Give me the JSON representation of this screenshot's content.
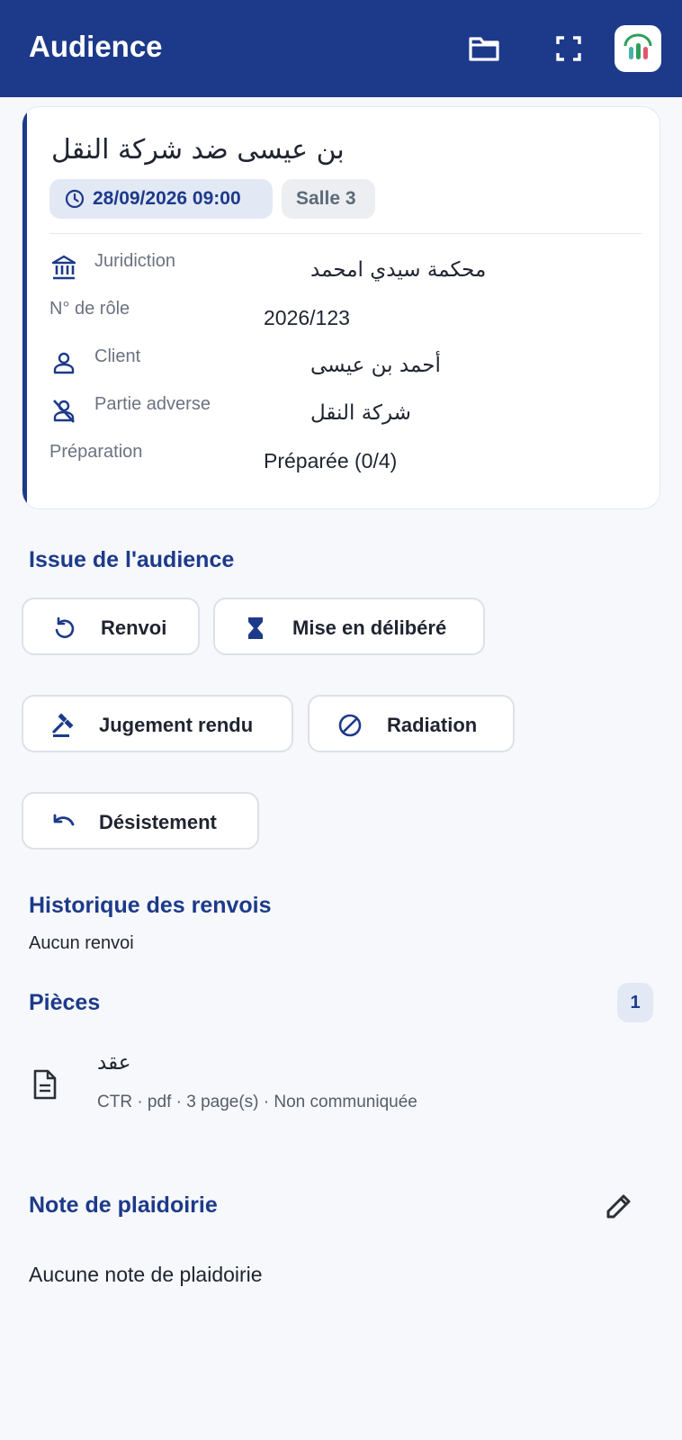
{
  "header": {
    "title": "Audience",
    "icons": [
      "folder-icon",
      "fullscreen-icon",
      "app-logo"
    ],
    "background": "#1d3a8a"
  },
  "hearing": {
    "case_title": "بن عيسى ضد شركة النقل",
    "datetime": "28/09/2026 09:00",
    "room": "Salle 3",
    "fields": {
      "jurisdiction": {
        "label": "Juridiction",
        "value": "محكمة سيدي امحمد"
      },
      "role_number": {
        "label": "N° de rôle",
        "value": "2026/123"
      },
      "client": {
        "label": "Client",
        "value": "أحمد بن عيسى"
      },
      "adverse": {
        "label": "Partie adverse",
        "value": "شركة النقل"
      },
      "preparation": {
        "label": "Préparation",
        "value": "Préparée (0/4)"
      }
    }
  },
  "outcome": {
    "title": "Issue de l'audience",
    "buttons": {
      "renvoi": "Renvoi",
      "deliberation": "Mise en délibéré",
      "judgment": "Jugement rendu",
      "radiation": "Radiation",
      "withdrawal": "Désistement"
    }
  },
  "history": {
    "title": "Historique des renvois",
    "empty": "Aucun renvoi"
  },
  "documents": {
    "title": "Pièces",
    "count": "1",
    "items": [
      {
        "name": "عقد",
        "meta": "CTR · pdf · 3 page(s) · Non communiquée"
      }
    ]
  },
  "note": {
    "title": "Note de plaidoirie",
    "empty": "Aucune note de plaidoirie"
  },
  "colors": {
    "accent": "#1d3a8a",
    "logo_green": "#2e9e5b",
    "logo_teal": "#46b3a8",
    "logo_red": "#e0566b"
  }
}
